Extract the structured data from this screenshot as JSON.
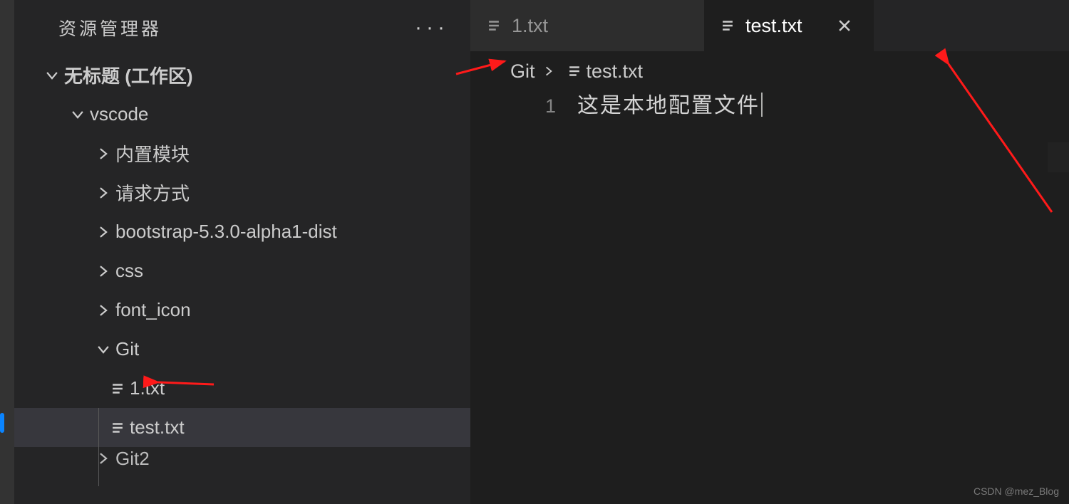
{
  "sidebar": {
    "title": "资源管理器",
    "workspace": "无标题 (工作区)",
    "tree": {
      "project": "vscode",
      "folders": [
        "内置模块",
        "请求方式",
        "bootstrap-5.3.0-alpha1-dist",
        "css",
        "font_icon"
      ],
      "git_folder": "Git",
      "git_files": [
        "1.txt",
        "test.txt"
      ],
      "next_folder": "Git2"
    }
  },
  "tabs": [
    {
      "name": "1.txt",
      "active": false
    },
    {
      "name": "test.txt",
      "active": true
    }
  ],
  "breadcrumb": {
    "folder": "Git",
    "file": "test.txt"
  },
  "editor": {
    "line_number": "1",
    "content": "这是本地配置文件"
  },
  "watermark": "CSDN @mez_Blog"
}
